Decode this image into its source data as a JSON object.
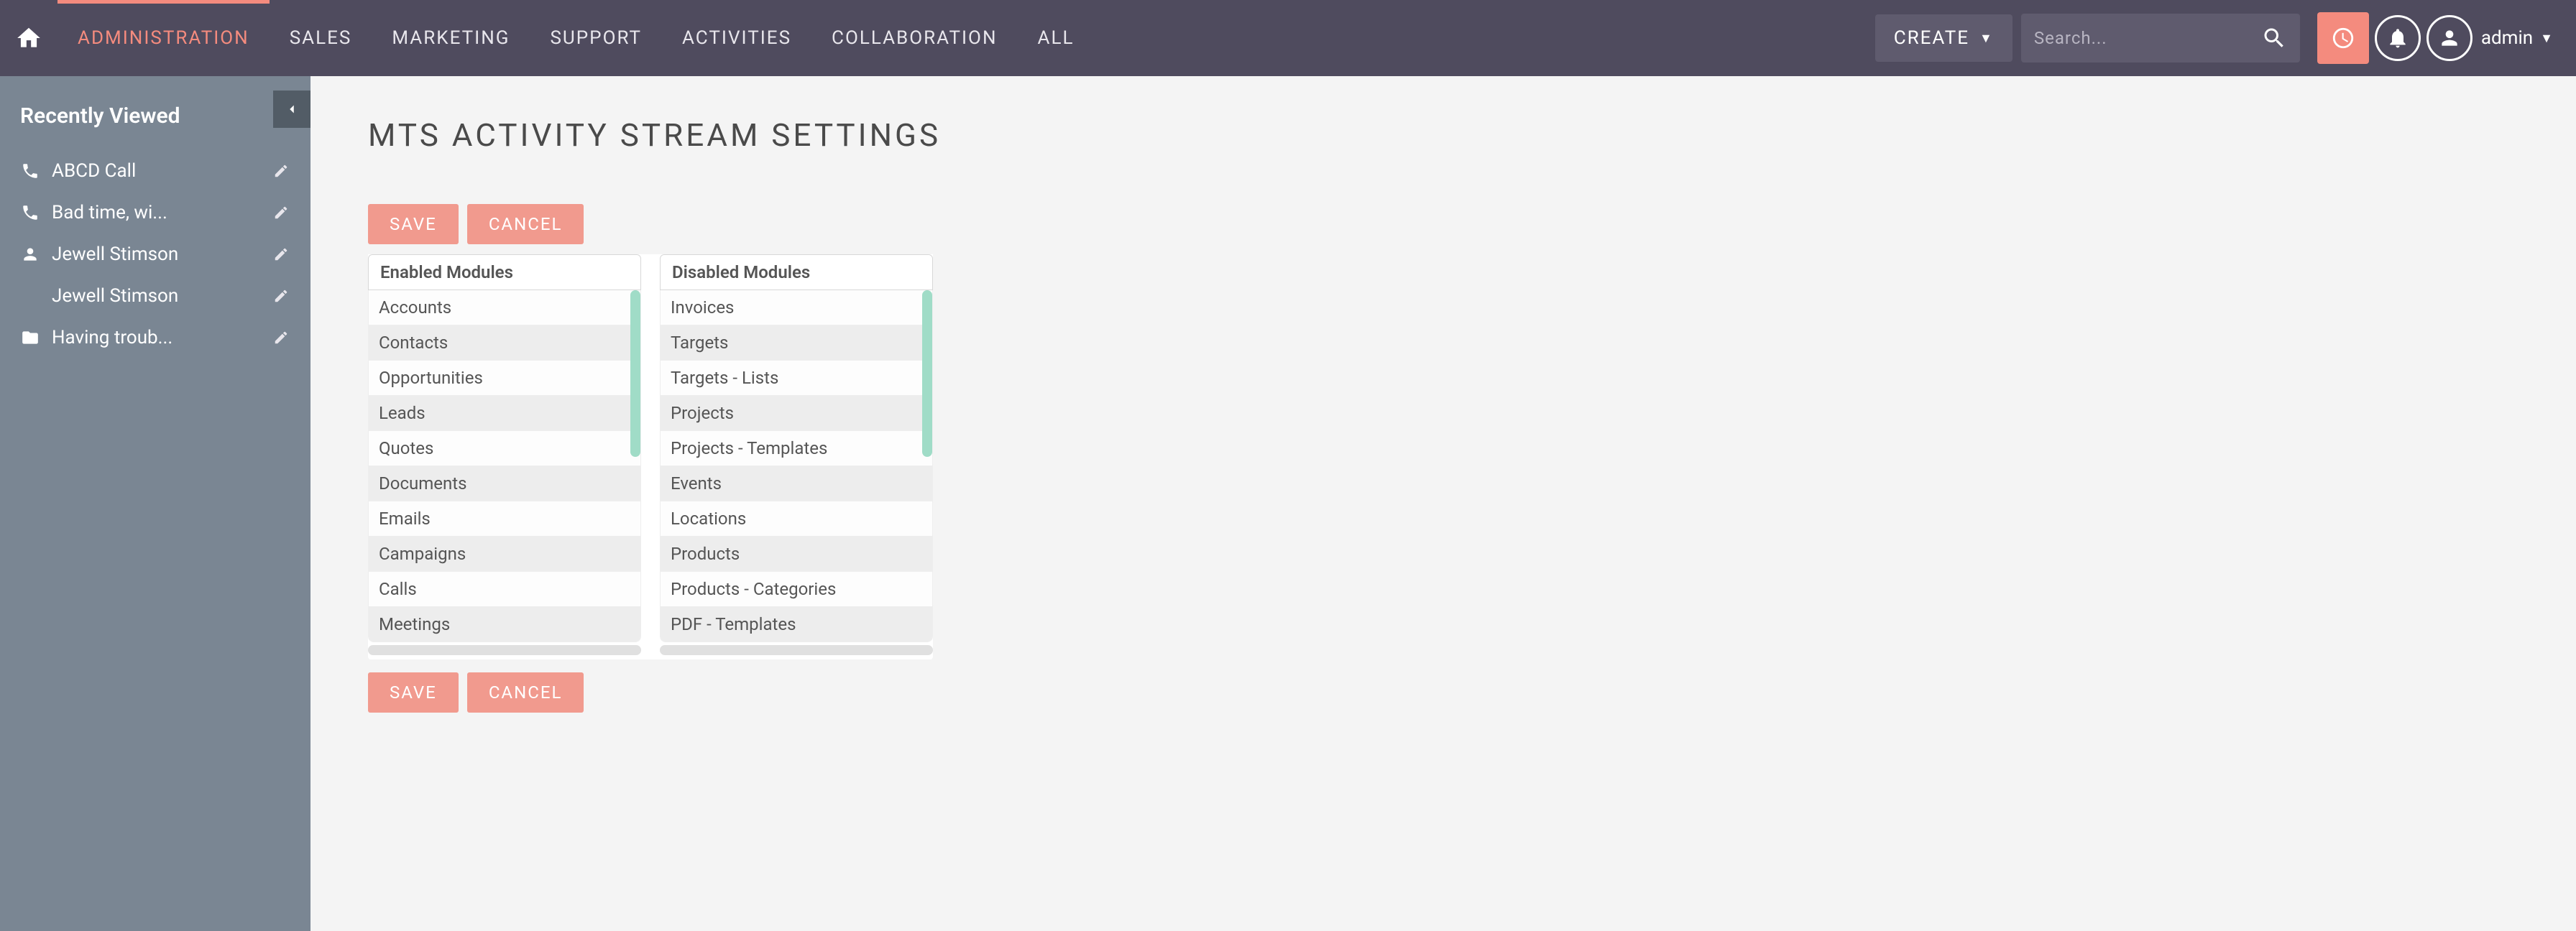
{
  "nav": {
    "items": [
      "ADMINISTRATION",
      "SALES",
      "MARKETING",
      "SUPPORT",
      "ACTIVITIES",
      "COLLABORATION",
      "ALL"
    ],
    "active_index": 0,
    "create_label": "CREATE",
    "search_placeholder": "Search...",
    "user_label": "admin"
  },
  "sidebar": {
    "title": "Recently Viewed",
    "items": [
      {
        "icon": "phone",
        "label": "ABCD Call"
      },
      {
        "icon": "phone",
        "label": "Bad time, wi..."
      },
      {
        "icon": "person",
        "label": "Jewell Stimson"
      },
      {
        "icon": "none",
        "label": "Jewell Stimson"
      },
      {
        "icon": "folder",
        "label": "Having troub..."
      }
    ]
  },
  "page": {
    "title": "MTS ACTIVITY STREAM SETTINGS",
    "save_label": "SAVE",
    "cancel_label": "CANCEL",
    "enabled_header": "Enabled Modules",
    "disabled_header": "Disabled Modules",
    "enabled_modules": [
      "Accounts",
      "Contacts",
      "Opportunities",
      "Leads",
      "Quotes",
      "Documents",
      "Emails",
      "Campaigns",
      "Calls",
      "Meetings"
    ],
    "disabled_modules": [
      "Invoices",
      "Targets",
      "Targets - Lists",
      "Projects",
      "Projects - Templates",
      "Events",
      "Locations",
      "Products",
      "Products - Categories",
      "PDF - Templates"
    ]
  }
}
